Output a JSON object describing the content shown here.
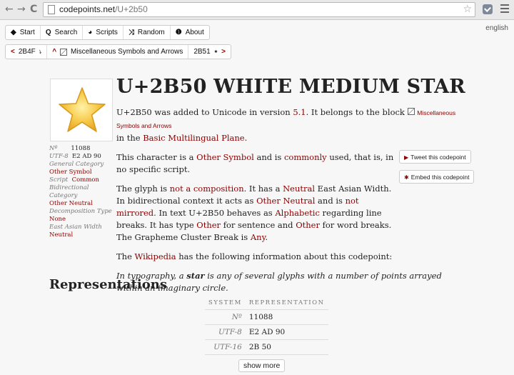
{
  "browser": {
    "back": "←",
    "forward": "→",
    "reload": "C",
    "url_host": "codepoints.net",
    "url_path": "/U+2b50",
    "bookmark": "☆"
  },
  "site_nav": {
    "items": [
      {
        "icon": "◆",
        "label": "Start"
      },
      {
        "icon": "Q",
        "label": "Search"
      },
      {
        "icon": "◕",
        "label": "Scripts"
      },
      {
        "icon": "⤨",
        "label": "Random"
      },
      {
        "icon": "❶",
        "label": "About"
      }
    ],
    "language": "english"
  },
  "crumbs": {
    "prev_code": "2B4F",
    "prev_glyph": "⭏",
    "block_label": "Miscellaneous Symbols and Arrows",
    "next_code": "2B51",
    "next_glyph": "⭑"
  },
  "title": "U+2B50 WHITE MEDIUM STAR",
  "props": [
    {
      "label": "Nº",
      "value": "11088"
    },
    {
      "label": "UTF-8",
      "value": "E2 AD 90"
    },
    {
      "label": "General Category",
      "value": "Other Symbol"
    },
    {
      "label": "Script",
      "value": "Common"
    },
    {
      "label": "Bidirectional Category",
      "value": "Other Neutral"
    },
    {
      "label": "Decomposition Type",
      "value": "None"
    },
    {
      "label": "East Asian Width",
      "value": "Neutral"
    }
  ],
  "para1": {
    "a": "U+2B50 was added to Unicode in version ",
    "version": "5.1",
    "b": ". It belongs to the block ",
    "block": "Miscellaneous Symbols and Arrows",
    "c": " in the ",
    "plane": "Basic Multilingual Plane",
    "d": "."
  },
  "para2": {
    "a": "This character is a ",
    "category": "Other Symbol",
    "b": " and is ",
    "commonly": "commonly",
    "c": " used, that is, in no specific script."
  },
  "para3": {
    "a": "The glyph is ",
    "composition": "not a composition",
    "b": ". It has a ",
    "neutral": "Neutral",
    "c": " East Asian Width. In bidirectional context it acts as ",
    "other_neutral": "Other Neutral",
    "d": " and is ",
    "mirrored": "not mirrored",
    "e": ". In text U+2B50 behaves as ",
    "alphabetic": "Alphabetic",
    "f": " regarding line breaks. It has type ",
    "other1": "Other",
    "g": " for sentence and ",
    "other2": "Other",
    "h": " for word breaks. The Grapheme Cluster Break is ",
    "any": "Any",
    "i": "."
  },
  "para4": {
    "a": "The ",
    "wikipedia": "Wikipedia",
    "b": " has the following information about this codepoint:"
  },
  "quote": {
    "a": "In typography, a ",
    "star": "star",
    "b": " is any of several glyphs with a number of points arrayed within an imaginary circle."
  },
  "buttons": {
    "tweet": "Tweet this codepoint",
    "embed": "Embed this codepoint",
    "show_more": "show more"
  },
  "representations": {
    "heading": "Representations",
    "col_system": "System",
    "col_repr": "Representation",
    "rows": [
      {
        "system": "Nº",
        "value": "11088"
      },
      {
        "system": "UTF-8",
        "value": "E2 AD 90"
      },
      {
        "system": "UTF-16",
        "value": "2B 50"
      }
    ]
  },
  "colors": {
    "link": "#8b0000",
    "star_fill": "#f7c948",
    "star_stroke": "#d89a1a"
  }
}
